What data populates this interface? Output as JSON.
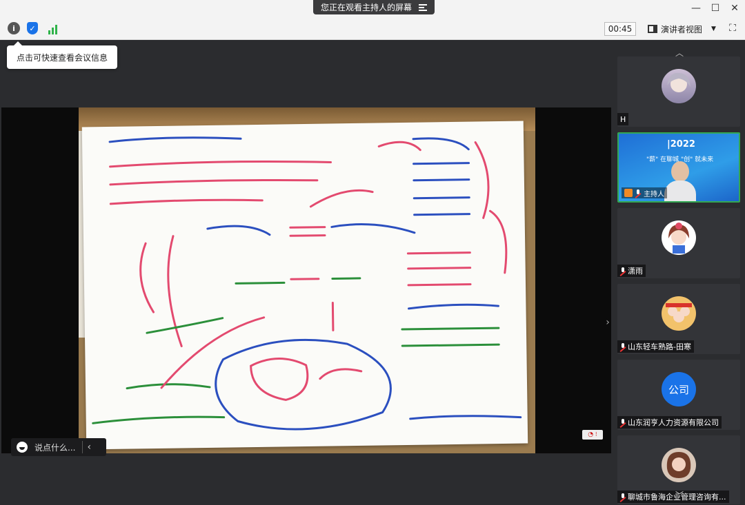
{
  "banner": {
    "text": "您正在观看主持人的屏幕"
  },
  "window": {
    "minimize": "—",
    "maximize": "☐",
    "close": "✕"
  },
  "toolbar": {
    "info_icon": "i",
    "timer": "00:45",
    "view_label": "演讲者视图",
    "view_caret": "▼",
    "fullscreen": "⛶"
  },
  "tooltip": {
    "text": "点击可快速查看会议信息"
  },
  "comment": {
    "placeholder": "说点什么...",
    "chevron": "‹"
  },
  "share_tag": "◔ ⁝",
  "panel": {
    "scroll_up": "︿",
    "scroll_down": "﹀",
    "host_banner_title": "|2022",
    "host_banner_sub": "\"薪\" 在聊城 \"创\" 就未来",
    "host_label": "主持人",
    "participants": [
      {
        "name": "H",
        "avatar": "anime",
        "muted": false
      },
      {
        "name": "潇雨",
        "avatar": "cartoon-girl",
        "muted": true
      },
      {
        "name": "山东轻车熟路-田寒",
        "avatar": "cartoon-group",
        "muted": true
      },
      {
        "name": "山东润亨人力资源有限公司",
        "avatar_text": "公司",
        "muted": true
      },
      {
        "name": "聊城市鲁海企业管理咨询有...",
        "avatar": "portrait",
        "muted": true
      }
    ]
  },
  "colors": {
    "accent": "#1a73e8",
    "active_border": "#33a853",
    "muted": "#e33333"
  }
}
